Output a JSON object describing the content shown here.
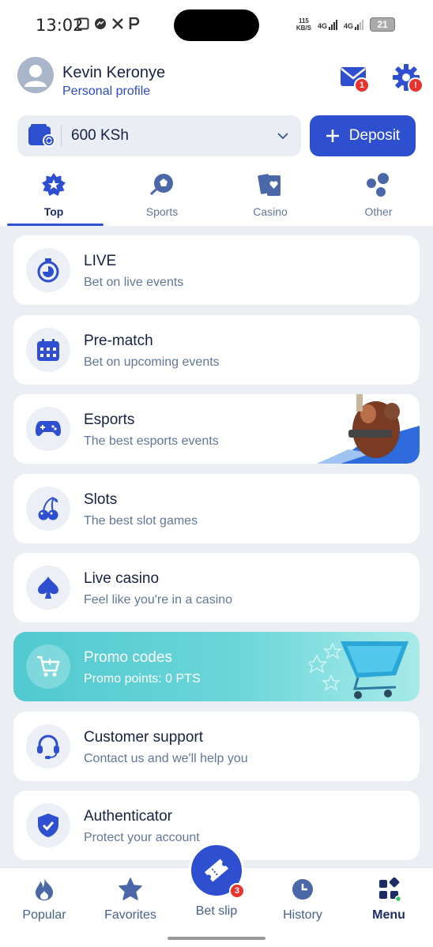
{
  "status_bar": {
    "time": "13:02",
    "net_speed_top": "115",
    "net_speed_bottom": "KB/S",
    "sim1": "4G",
    "sim2": "4G",
    "battery": "21"
  },
  "header": {
    "user_name": "Kevin Keronye",
    "profile_link": "Personal profile",
    "messages_badge": "1",
    "settings_badge": "!"
  },
  "balance": {
    "amount": "600 KSh",
    "deposit_label": "Deposit"
  },
  "tabs": [
    {
      "label": "Top",
      "active": true
    },
    {
      "label": "Sports",
      "active": false
    },
    {
      "label": "Casino",
      "active": false
    },
    {
      "label": "Other",
      "active": false
    }
  ],
  "menu": [
    {
      "title": "LIVE",
      "subtitle": "Bet on live events",
      "icon": "stopwatch-icon"
    },
    {
      "title": "Pre-match",
      "subtitle": "Bet on upcoming events",
      "icon": "calendar-icon"
    },
    {
      "title": "Esports",
      "subtitle": "The best esports events",
      "icon": "gamepad-icon"
    },
    {
      "title": "Slots",
      "subtitle": "The best slot games",
      "icon": "cherries-icon"
    },
    {
      "title": "Live casino",
      "subtitle": "Feel like you're in a casino",
      "icon": "spade-icon"
    },
    {
      "title": "Promo codes",
      "subtitle": "Promo points: 0 PTS",
      "icon": "cart-icon"
    },
    {
      "title": "Customer support",
      "subtitle": "Contact us and we'll help you",
      "icon": "headset-icon"
    },
    {
      "title": "Authenticator",
      "subtitle": "Protect your account",
      "icon": "shield-check-icon"
    }
  ],
  "bottom_nav": {
    "popular": "Popular",
    "favorites": "Favorites",
    "betslip": "Bet slip",
    "betslip_badge": "3",
    "history": "History",
    "menu": "Menu"
  },
  "colors": {
    "accent": "#2e4fd0",
    "text_dark": "#152244",
    "text_muted": "#5f7799",
    "badge": "#e8332f",
    "promo": "#50c9cf"
  }
}
